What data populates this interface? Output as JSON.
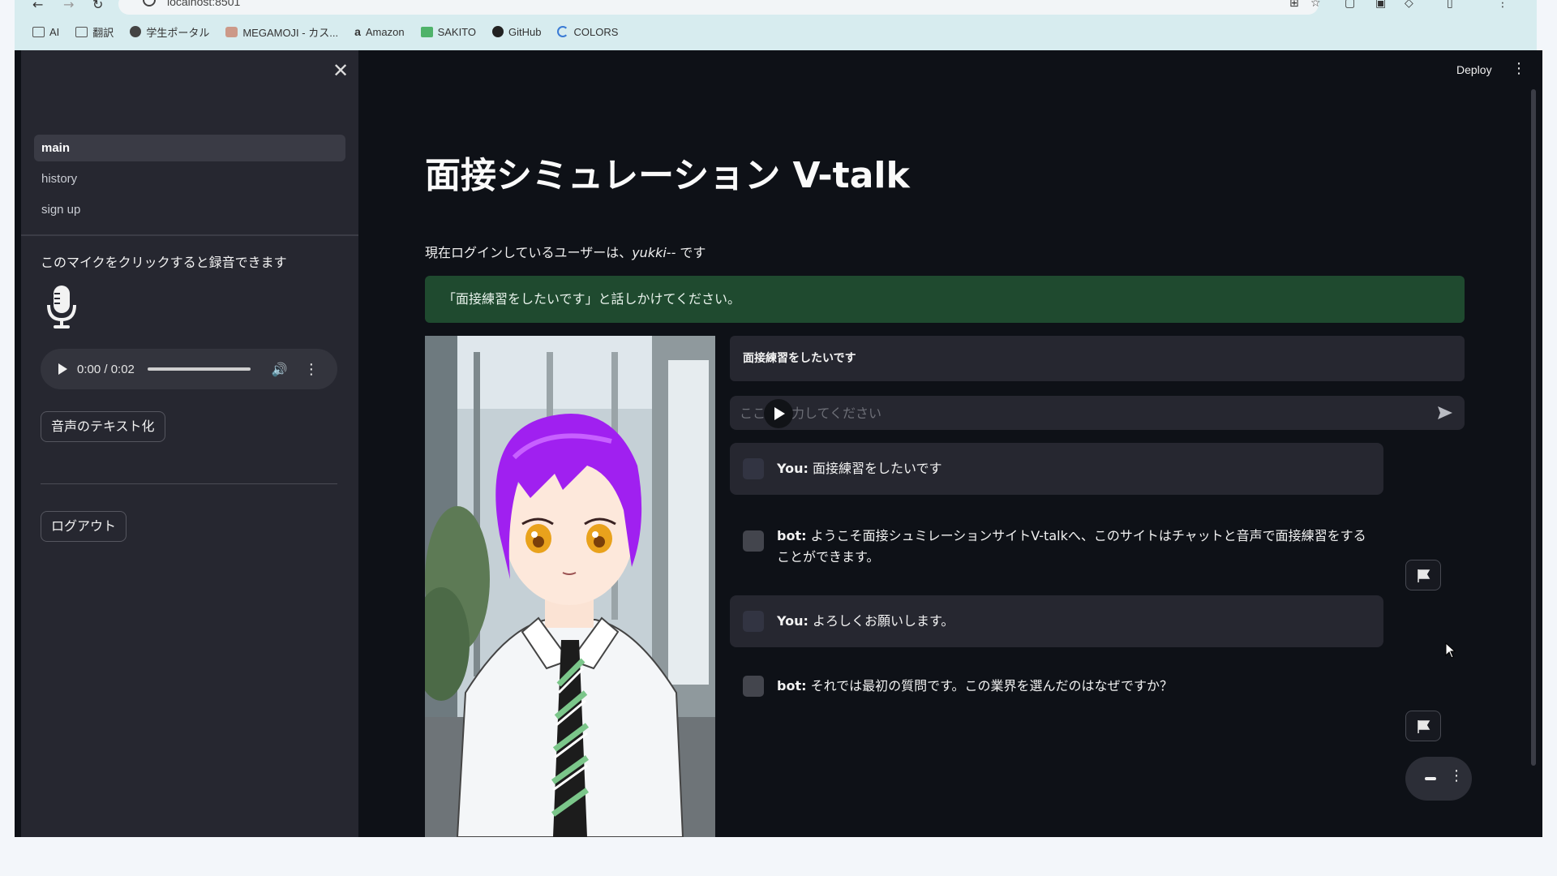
{
  "browser": {
    "url": "localhost:8501",
    "bookmarks": [
      "AI",
      "翻訳",
      "学生ポータル",
      "MEGAMOJI - カス...",
      "Amazon",
      "SAKITO",
      "GitHub",
      "COLORS"
    ]
  },
  "sidebar": {
    "nav": [
      {
        "label": "main",
        "active": true
      },
      {
        "label": "history",
        "active": false
      },
      {
        "label": "sign up",
        "active": false
      }
    ],
    "mic_label": "このマイクをクリックすると録音できます",
    "audio_time": "0:00 / 0:02",
    "stt_button": "音声のテキスト化",
    "logout_button": "ログアウト"
  },
  "header": {
    "deploy": "Deploy"
  },
  "main": {
    "title": "面接シミュレーション V-talk",
    "login_prefix": "現在ログインしているユーザーは、",
    "login_user": "yukki--",
    "login_suffix": " です",
    "alert": "「面接練習をしたいです」と話しかけてください。",
    "transcript": "面接練習をしたいです",
    "input_placeholder": "ここに入力してください",
    "messages": [
      {
        "role": "user",
        "speaker": "You:",
        "text": " 面接練習をしたいです"
      },
      {
        "role": "bot",
        "speaker": "bot:",
        "text": " ようこそ面接シュミレーションサイトV-talkへ、このサイトはチャットと音声で面接練習をすることができます。"
      },
      {
        "role": "user",
        "speaker": "You:",
        "text": " よろしくお願いします。"
      },
      {
        "role": "bot",
        "speaker": "bot:",
        "text": " それでは最初の質問です。この業界を選んだのはなぜですか？"
      }
    ]
  },
  "colors": {
    "app_bg": "#0e1117",
    "sidebar_bg": "#262730",
    "alert_bg": "#1f4a2f",
    "hair": "#a020f0"
  }
}
